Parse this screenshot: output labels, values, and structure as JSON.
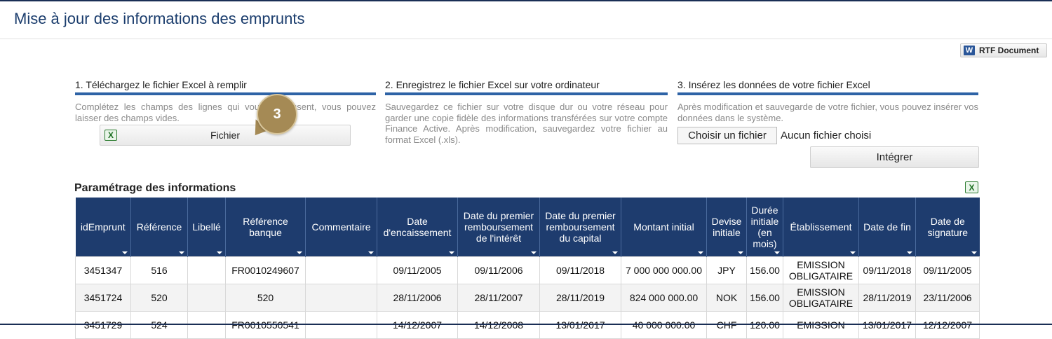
{
  "page": {
    "title": "Mise à jour des informations des emprunts"
  },
  "toolbar": {
    "rtf_label": "RTF Document",
    "rtf_icon": "word-icon"
  },
  "steps": [
    {
      "title": "1. Téléchargez le fichier Excel à remplir",
      "desc": "Complétez les champs des lignes qui vous intéressent, vous pouvez laisser des champs vides."
    },
    {
      "title": "2. Enregistrez le fichier Excel sur votre ordinateur",
      "desc": "Sauvegardez ce fichier sur votre disque dur ou votre réseau pour garder une copie fidèle des informations transférées sur votre compte Finance Active. Après modification, sauvegardez votre fichier au format Excel (.xls)."
    },
    {
      "title": "3. Insérez les données de votre fichier Excel",
      "desc": "Après modification et sauvegarde de votre fichier, vous pouvez insérer vos données dans le système."
    }
  ],
  "download": {
    "label": "Fichier",
    "icon": "excel-icon"
  },
  "callout": {
    "number": "3"
  },
  "upload": {
    "choose_label": "Choisir un fichier",
    "no_file_label": "Aucun fichier choisi",
    "integrate_label": "Intégrer"
  },
  "params": {
    "title": "Paramétrage des informations",
    "export_icon": "excel-icon"
  },
  "table": {
    "columns": [
      "idEmprunt",
      "Référence",
      "Libellé",
      "Référence banque",
      "Commentaire",
      "Date d'encaissement",
      "Date du premier remboursement de l'intérêt",
      "Date du premier remboursement du capital",
      "Montant initial",
      "Devise initiale",
      "Durée initiale (en mois)",
      "Établissement",
      "Date de fin",
      "Date de signature"
    ],
    "rows": [
      [
        "3451347",
        "516",
        "",
        "FR0010249607",
        "",
        "09/11/2005",
        "09/11/2006",
        "09/11/2018",
        "7 000 000 000.00",
        "JPY",
        "156.00",
        "EMISSION OBLIGATAIRE",
        "09/11/2018",
        "09/11/2005"
      ],
      [
        "3451724",
        "520",
        "",
        "520",
        "",
        "28/11/2006",
        "28/11/2007",
        "28/11/2019",
        "824 000 000.00",
        "NOK",
        "156.00",
        "EMISSION OBLIGATAIRE",
        "28/11/2019",
        "23/11/2006"
      ],
      [
        "3451729",
        "524",
        "",
        "FR0010550541",
        "",
        "14/12/2007",
        "14/12/2008",
        "13/01/2017",
        "40 000 000.00",
        "CHF",
        "120.00",
        "EMISSION",
        "13/01/2017",
        "12/12/2007"
      ]
    ]
  },
  "colors": {
    "header_bg": "#1e3c6e",
    "accent": "#2e63a6",
    "title": "#1b3d6d"
  }
}
